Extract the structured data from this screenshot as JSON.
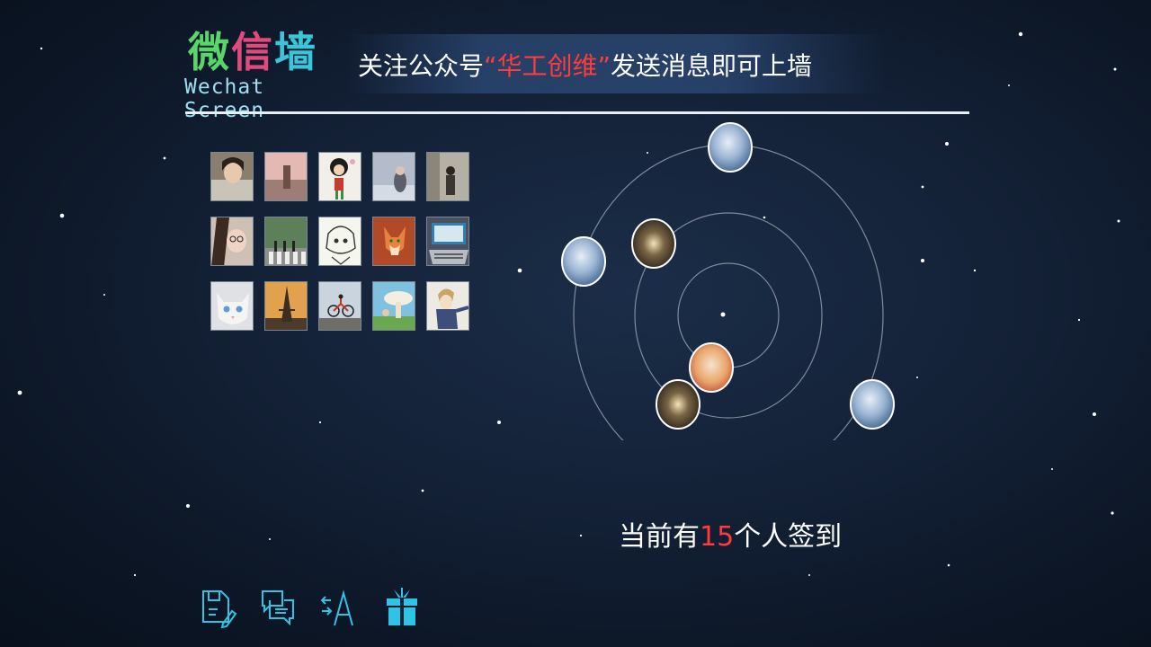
{
  "logo": {
    "chars": [
      "微",
      "信",
      "墙"
    ],
    "subtitle": "Wechat Screen",
    "colors": [
      "#58d66a",
      "#e04a7c",
      "#3ac6d8"
    ]
  },
  "banner": {
    "prefix": "关注公众号",
    "highlight": "“华工创维”",
    "suffix": "发送消息即可上墙",
    "highlight_color": "#ff3b3b"
  },
  "avatars": [
    {
      "row": 0,
      "col": 0,
      "name": "avatar-girl-portrait"
    },
    {
      "row": 0,
      "col": 1,
      "name": "avatar-sunset-photo"
    },
    {
      "row": 0,
      "col": 2,
      "name": "avatar-cartoon-girl"
    },
    {
      "row": 0,
      "col": 3,
      "name": "avatar-winter-girl"
    },
    {
      "row": 0,
      "col": 4,
      "name": "avatar-girl-wall"
    },
    {
      "row": 1,
      "col": 0,
      "name": "avatar-glasses-girl"
    },
    {
      "row": 1,
      "col": 1,
      "name": "avatar-abbey-road"
    },
    {
      "row": 1,
      "col": 2,
      "name": "avatar-anime-sketch"
    },
    {
      "row": 1,
      "col": 3,
      "name": "avatar-fox-cartoon"
    },
    {
      "row": 1,
      "col": 4,
      "name": "avatar-laptop"
    },
    {
      "row": 2,
      "col": 0,
      "name": "avatar-white-cat"
    },
    {
      "row": 2,
      "col": 1,
      "name": "avatar-eiffel-tower"
    },
    {
      "row": 2,
      "col": 2,
      "name": "avatar-cyclist"
    },
    {
      "row": 2,
      "col": 3,
      "name": "avatar-mushroom-anime"
    },
    {
      "row": 2,
      "col": 4,
      "name": "avatar-anime-boy"
    }
  ],
  "signin": {
    "prefix": "当前有",
    "count": "15",
    "suffix": "个人签到"
  },
  "toolbar": {
    "buttons": [
      "notes-icon",
      "chat-icon",
      "font-icon",
      "gift-icon"
    ],
    "icon_color": "#2fc3e6"
  }
}
